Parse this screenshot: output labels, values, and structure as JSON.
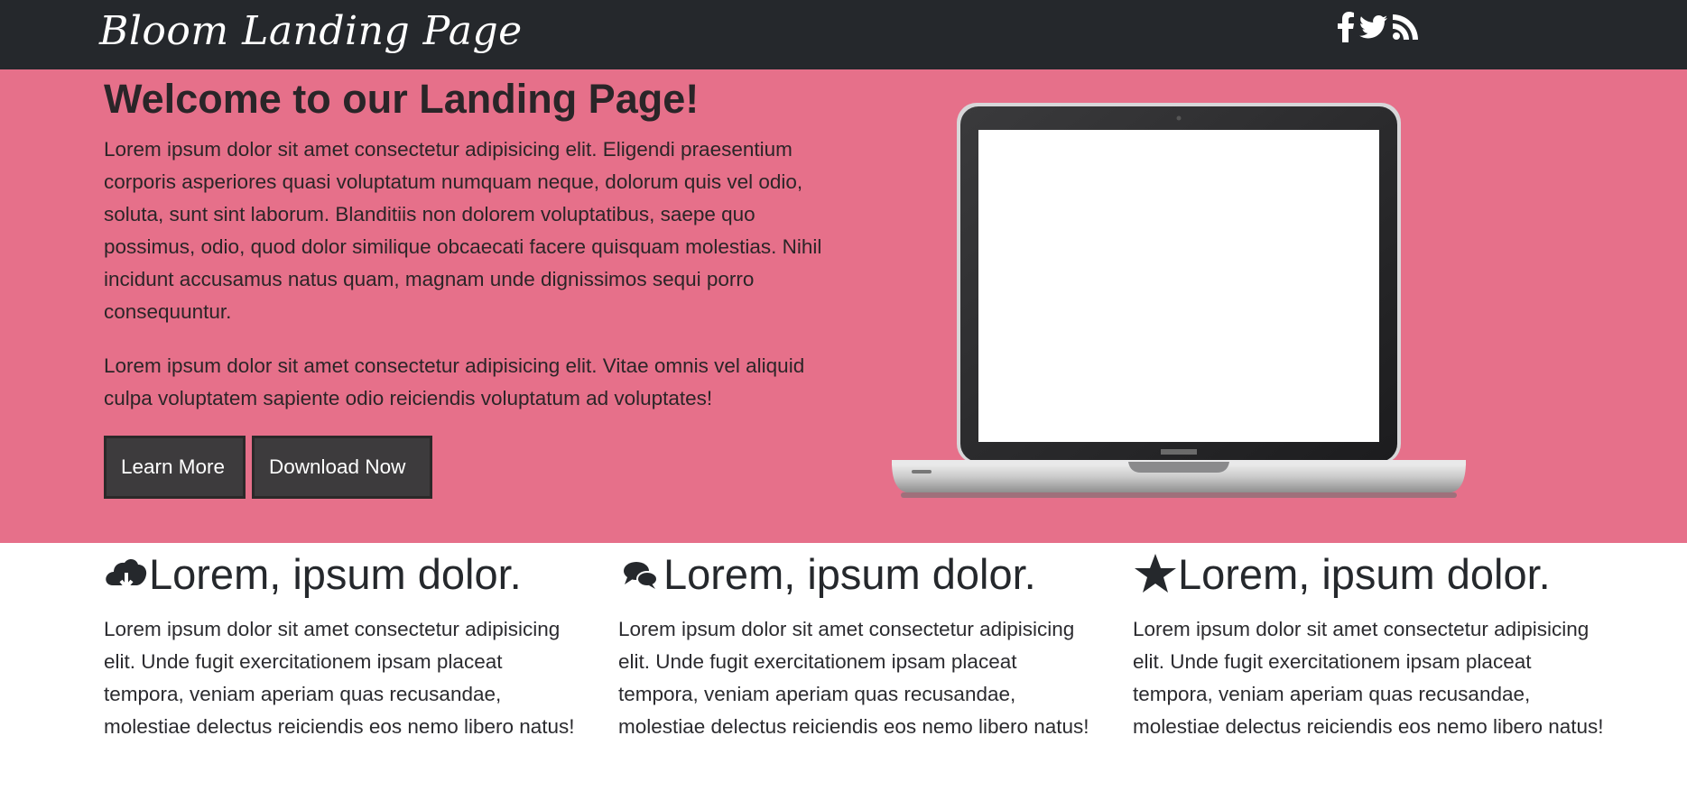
{
  "navbar": {
    "brand": "Bloom Landing Page",
    "social": [
      "facebook-icon",
      "twitter-icon",
      "rss-icon"
    ]
  },
  "hero": {
    "title": "Welcome to our Landing Page!",
    "paragraph_1": "Lorem ipsum dolor sit amet consectetur adipisicing elit. Eligendi praesentium corporis asperiores quasi voluptatum numquam neque, dolorum quis vel odio, soluta, sunt sint laborum. Blanditiis non dolorem voluptatibus, saepe quo possimus, odio, quod dolor similique obcaecati facere quisquam molestias. Nihil incidunt accusamus natus quam, magnam unde dignissimos sequi porro consequuntur.",
    "paragraph_2": "Lorem ipsum dolor sit amet consectetur adipisicing elit. Vitae omnis vel aliquid culpa voluptatem sapiente odio reiciendis voluptatum ad voluptates!",
    "learn_more_label": "Learn More",
    "download_label": "Download Now",
    "image": "laptop"
  },
  "features": [
    {
      "icon": "cloud-download-icon",
      "title": "Lorem, ipsum dolor.",
      "text": "Lorem ipsum dolor sit amet consectetur adipisicing elit. Unde fugit exercitationem ipsam placeat tempora, veniam aperiam quas recusandae, molestiae delectus reiciendis eos nemo libero natus!"
    },
    {
      "icon": "comments-icon",
      "title": "Lorem, ipsum dolor.",
      "text": "Lorem ipsum dolor sit amet consectetur adipisicing elit. Unde fugit exercitationem ipsam placeat tempora, veniam aperiam quas recusandae, molestiae delectus reiciendis eos nemo libero natus!"
    },
    {
      "icon": "star-icon",
      "title": "Lorem, ipsum dolor.",
      "text": "Lorem ipsum dolor sit amet consectetur adipisicing elit. Unde fugit exercitationem ipsam placeat tempora, veniam aperiam quas recusandae, molestiae delectus reiciendis eos nemo libero natus!"
    }
  ],
  "colors": {
    "navbar_bg": "#25282c",
    "hero_bg": "#e6708a",
    "button_bg": "#3d3b3d",
    "text_dark": "#212529"
  }
}
